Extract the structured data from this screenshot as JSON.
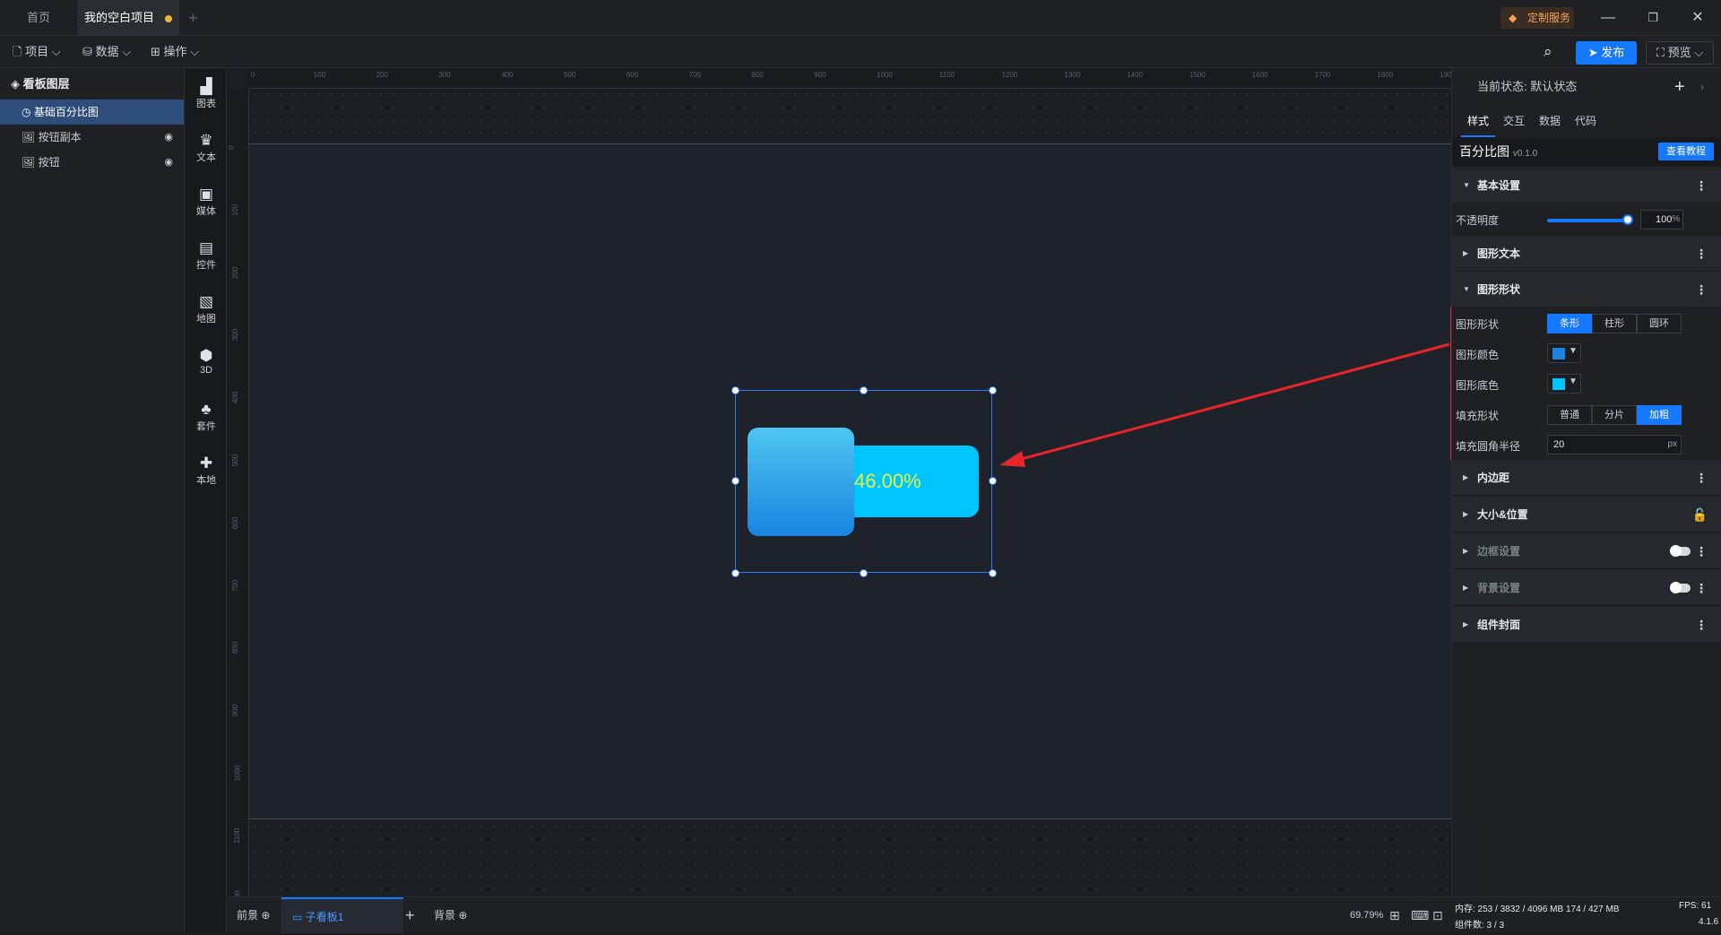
{
  "tabs": {
    "home": "首页",
    "project": "我的空白项目"
  },
  "custom_service": "定制服务",
  "menus": {
    "project": "项目",
    "data": "数据",
    "ops": "操作"
  },
  "toolbar": {
    "publish": "发布",
    "preview": "预览"
  },
  "layers": {
    "title": "看板图层",
    "items": [
      {
        "label": "基础百分比图",
        "selected": true
      },
      {
        "label": "按钮副本"
      },
      {
        "label": "按钮"
      }
    ]
  },
  "components": [
    "图表",
    "文本",
    "媒体",
    "控件",
    "地图",
    "3D",
    "套件",
    "本地"
  ],
  "ruler_h": [
    "0",
    "100",
    "200",
    "300",
    "400",
    "500",
    "600",
    "700",
    "800",
    "900",
    "1000",
    "1100",
    "1200",
    "1300",
    "1400",
    "1500",
    "1600",
    "1700",
    "1800",
    "1900"
  ],
  "ruler_v": [
    "0",
    "100",
    "200",
    "300",
    "400",
    "500",
    "600",
    "700",
    "800",
    "900",
    "1000",
    "1100",
    "1200"
  ],
  "widget": {
    "value": 46.0,
    "text": "46.00%",
    "colors": {
      "track": "#00c4ff",
      "fill": "#1a84e0",
      "text": "#e6f53a"
    }
  },
  "bottom": {
    "front": "前景",
    "board": "子看板1",
    "back": "背景",
    "zoom": "69.79%"
  },
  "panel": {
    "state_label": "当前状态:",
    "state_value": "默认状态",
    "tabs": [
      "样式",
      "交互",
      "数据",
      "代码"
    ],
    "component_name": "百分比图",
    "version": "v0.1.0",
    "tutorial": "查看教程",
    "sections": {
      "basic": "基本设置",
      "opacity_label": "不透明度",
      "opacity_value": "100",
      "opacity_unit": "%",
      "shape_text": "图形文本",
      "shape": "图形形状",
      "shape_label": "图形形状",
      "shape_options": [
        "条形",
        "柱形",
        "圆环"
      ],
      "color_label": "图形颜色",
      "bg_color_label": "图形底色",
      "fill_label": "填充形状",
      "fill_options": [
        "普通",
        "分片",
        "加粗"
      ],
      "radius_label": "填充圆角半径",
      "radius_value": "20",
      "radius_unit": "px",
      "padding": "内边距",
      "size_pos": "大小&位置",
      "border": "边框设置",
      "background": "背景设置",
      "cover": "组件封面"
    },
    "colors": {
      "shape_color": "#1a84e0",
      "bg_color": "#00c4ff"
    }
  },
  "status": {
    "memory": "内存: 253 / 3832 / 4096 MB  174 / 427 MB",
    "fps": "FPS: 61",
    "count": "组件数: 3 / 3",
    "version": "4.1.6"
  }
}
